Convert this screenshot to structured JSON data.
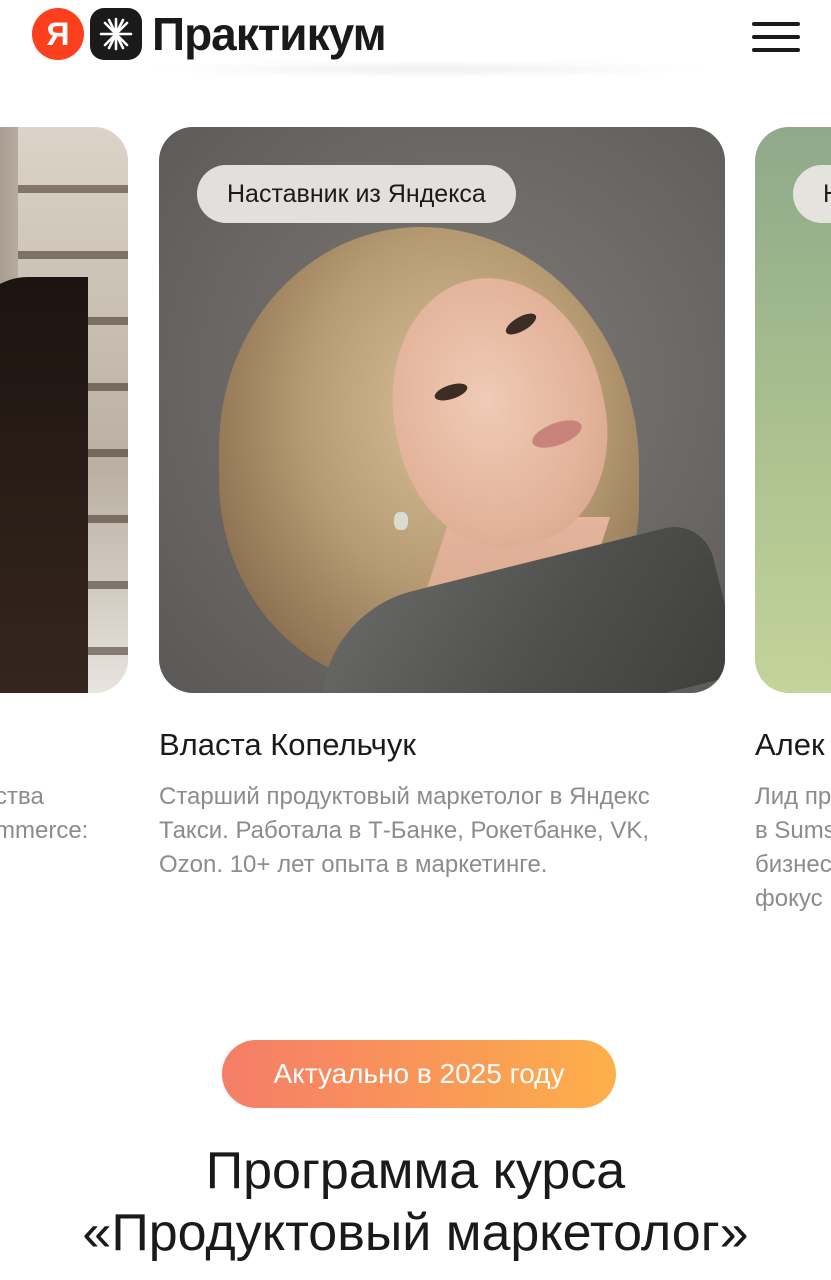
{
  "header": {
    "logo_letter": "Я",
    "brand": "Практикум",
    "menu_icon": "burger-menu-icon"
  },
  "mentors": [
    {
      "name": "",
      "desc_lines": [
        "ства",
        "mmerce:"
      ]
    },
    {
      "badge": "Наставник из Яндекса",
      "name": "Власта Копельчук",
      "desc_lines": [
        "Старший продуктовый маркетолог в Яндекс",
        "Такси. Работала в Т-Банке, Рокетбанке, VK,",
        "Ozon. 10+ лет опыта в маркетинге."
      ]
    },
    {
      "badge": "Н",
      "name": "Алек",
      "desc_lines": [
        "Лид пр",
        "в Sums",
        "бизнес",
        "фокус"
      ]
    }
  ],
  "program": {
    "pill": "Актуально в 2025 году",
    "title_line1": "Программа курса",
    "title_line2": "«Продуктовый маркетолог»"
  },
  "colors": {
    "yandex_red": "#fc3f1d",
    "pill_gradient_start": "#f57d68",
    "pill_gradient_end": "#fcb04a"
  }
}
